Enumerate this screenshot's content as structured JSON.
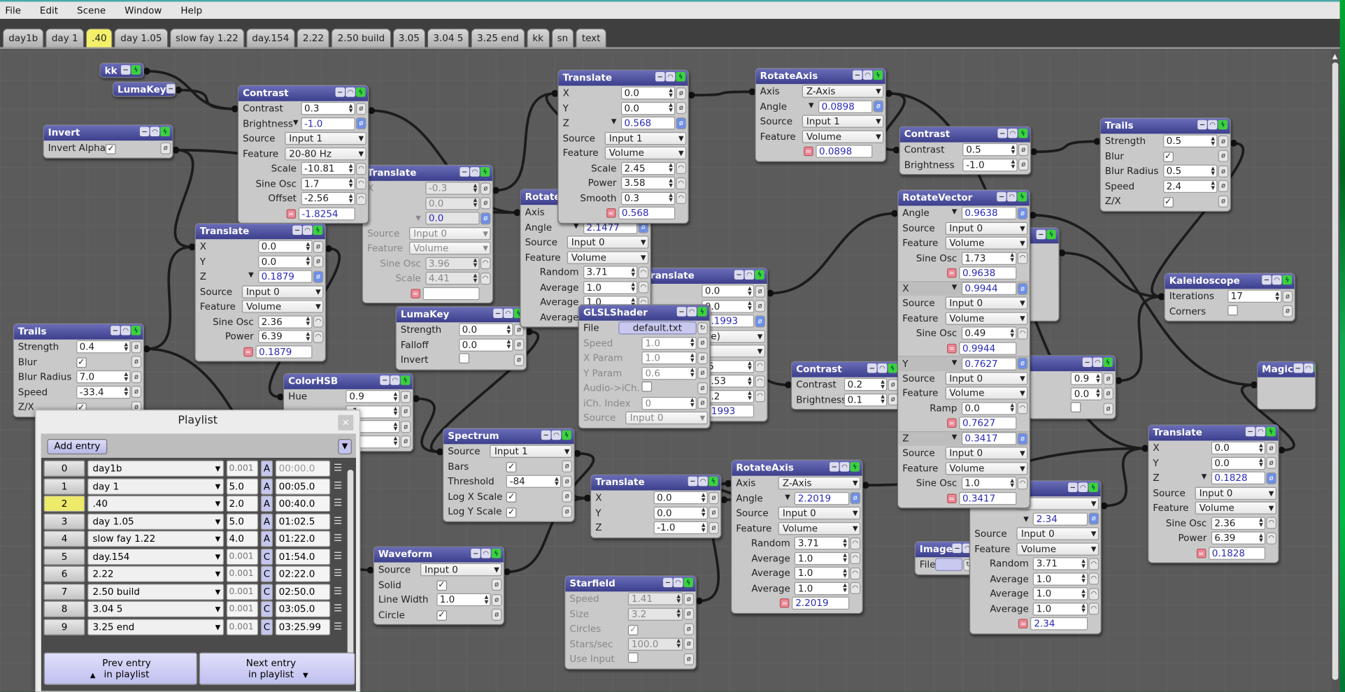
{
  "menu": [
    "File",
    "Edit",
    "Scene",
    "Window",
    "Help"
  ],
  "tabs": {
    "items": [
      "day1b",
      "day 1",
      ".40",
      "day 1.05",
      "slow fay 1.22",
      "day.154",
      "2.22",
      "2.50 build",
      "3.05",
      "3.04 5",
      "3.25 end",
      "kk",
      "sn",
      "text"
    ],
    "active": ".40"
  },
  "colors": {
    "node_header": "#3c3f8c",
    "active_tab": "#f4f06a",
    "result_value": "#2a2ab8",
    "canvas": "#5b5b5b"
  },
  "nodes": [
    {
      "title": "kk",
      "rows": []
    },
    {
      "title": "LumaKey",
      "rows": []
    },
    {
      "title": "Translate",
      "disabled": true,
      "rows": [
        {
          "t": "num",
          "l": "X",
          "v": "-0.3"
        },
        {
          "t": "num",
          "l": "",
          "v": "0.0"
        },
        {
          "t": "drop",
          "l": "",
          "v": "0.0"
        },
        {
          "t": "sel",
          "l": "Source",
          "v": "Input 0"
        },
        {
          "t": "sel",
          "l": "Feature",
          "v": "Volume"
        },
        {
          "t": "mod",
          "l": "Sine Osc",
          "v": "3.96"
        },
        {
          "t": "mod",
          "l": "Scale",
          "v": "4.41"
        },
        {
          "t": "res",
          "v": ""
        }
      ]
    },
    {
      "title": "Contrast",
      "rows": [
        {
          "t": "num",
          "l": "Contrast",
          "v": "0.3"
        },
        {
          "t": "drop",
          "l": "Brightness",
          "v": "-1.0"
        },
        {
          "t": "sel",
          "l": "Source",
          "v": "Input 1"
        },
        {
          "t": "sel",
          "l": "Feature",
          "v": "20-80 Hz"
        },
        {
          "t": "mod",
          "l": "Scale",
          "v": "-10.81"
        },
        {
          "t": "mod",
          "l": "Sine Osc",
          "v": "1.7"
        },
        {
          "t": "mod",
          "l": "Offset",
          "v": "-2.56"
        },
        {
          "t": "res",
          "v": "-1.8254"
        }
      ]
    },
    {
      "title": "Invert",
      "rows": [
        {
          "t": "chk",
          "l": "Invert Alpha",
          "v": true
        }
      ]
    },
    {
      "title": "Translate",
      "rows": [
        {
          "t": "num",
          "l": "X",
          "v": "0.0"
        },
        {
          "t": "num",
          "l": "Y",
          "v": "0.0"
        },
        {
          "t": "drop",
          "l": "Z",
          "v": "0.1879"
        },
        {
          "t": "sel",
          "l": "Source",
          "v": "Input 0"
        },
        {
          "t": "sel",
          "l": "Feature",
          "v": "Volume"
        },
        {
          "t": "mod",
          "l": "Sine Osc",
          "v": "2.36"
        },
        {
          "t": "mod",
          "l": "Power",
          "v": "6.39"
        },
        {
          "t": "res",
          "v": "0.1879"
        }
      ]
    },
    {
      "title": "Trails",
      "rows": [
        {
          "t": "num",
          "l": "Strength",
          "v": "0.4"
        },
        {
          "t": "chk",
          "l": "Blur",
          "v": true
        },
        {
          "t": "num",
          "l": "Blur Radius",
          "v": "7.0"
        },
        {
          "t": "num",
          "l": "Speed",
          "v": "-33.4"
        },
        {
          "t": "chk",
          "l": "Z/X",
          "v": true
        }
      ]
    },
    {
      "title": "ColorHSB",
      "rows": [
        {
          "t": "num",
          "l": "Hue",
          "v": "0.9"
        },
        {
          "t": "num",
          "l": "",
          "v": ".1"
        },
        {
          "t": "num",
          "l": "",
          "v": ".1"
        },
        {
          "t": "num",
          "l": "",
          "v": ".0"
        }
      ]
    },
    {
      "title": "LumaKey",
      "rows": [
        {
          "t": "num",
          "l": "Strength",
          "v": "0.0"
        },
        {
          "t": "num",
          "l": "Falloff",
          "v": "0.0"
        },
        {
          "t": "chk",
          "l": "Invert",
          "v": false
        }
      ]
    },
    {
      "title": "Translate",
      "rows": [
        {
          "t": "num",
          "l": "",
          "v": "0.0"
        },
        {
          "t": "num",
          "l": "",
          "v": "0.0"
        },
        {
          "t": "drop",
          "l": "",
          "v": "0.1993"
        },
        {
          "t": "sel",
          "l": "",
          "v": "ource)"
        },
        {
          "t": "sel",
          "l": "",
          "v": "ne"
        },
        {
          "t": "mod",
          "l": "",
          "v": ".5"
        },
        {
          "t": "mod",
          "l": "",
          "v": "5.53"
        },
        {
          "t": "mod",
          "l": "",
          "v": "0.2"
        },
        {
          "t": "res",
          "v": "0.1993"
        }
      ]
    },
    {
      "title": "RotateAxis",
      "rows": [
        {
          "t": "sel",
          "l": "Axis",
          "v": ""
        },
        {
          "t": "drop",
          "l": "Angle",
          "v": "2.1477"
        },
        {
          "t": "sel",
          "l": "Source",
          "v": "Input 0"
        },
        {
          "t": "sel",
          "l": "Feature",
          "v": "Volume"
        },
        {
          "t": "mod",
          "l": "Random",
          "v": "3.71"
        },
        {
          "t": "mod",
          "l": "Average",
          "v": "1.0"
        },
        {
          "t": "mod",
          "l": "Average",
          "v": "1.0"
        },
        {
          "t": "mod",
          "l": "Average",
          "v": ""
        }
      ]
    },
    {
      "title": "Translate",
      "rows": [
        {
          "t": "num",
          "l": "X",
          "v": "0.0"
        },
        {
          "t": "num",
          "l": "Y",
          "v": "0.0"
        },
        {
          "t": "drop",
          "l": "Z",
          "v": "0.568"
        },
        {
          "t": "sel",
          "l": "Source",
          "v": "Input 1"
        },
        {
          "t": "sel",
          "l": "Feature",
          "v": "Volume"
        },
        {
          "t": "mod",
          "l": "Scale",
          "v": "2.45"
        },
        {
          "t": "mod",
          "l": "Power",
          "v": "3.58"
        },
        {
          "t": "mod",
          "l": "Smooth",
          "v": "0.3"
        },
        {
          "t": "res",
          "v": "0.568"
        }
      ]
    },
    {
      "title": "GLSLShader",
      "rows": [
        {
          "t": "file",
          "l": "File",
          "v": "default.txt"
        },
        {
          "t": "num",
          "l": "Speed",
          "v": "1.0",
          "dim": true
        },
        {
          "t": "num",
          "l": "X Param",
          "v": "1.0",
          "dim": true
        },
        {
          "t": "num",
          "l": "Y Param",
          "v": "0.6",
          "dim": true
        },
        {
          "t": "chk",
          "l": "Audio->iCh.",
          "v": false,
          "dim": true
        },
        {
          "t": "num",
          "l": "iCh. Index",
          "v": "0",
          "dim": true
        },
        {
          "t": "sel",
          "l": "Source",
          "v": "Input 0",
          "dim": true
        }
      ]
    },
    {
      "title": "Spectrum",
      "rows": [
        {
          "t": "sel",
          "l": "Source",
          "v": "Input 1"
        },
        {
          "t": "chk",
          "l": "Bars",
          "v": true
        },
        {
          "t": "num",
          "l": "Threshold",
          "v": "-84"
        },
        {
          "t": "chk",
          "l": "Log X Scale",
          "v": true
        },
        {
          "t": "chk",
          "l": "Log Y Scale",
          "v": true
        }
      ]
    },
    {
      "title": "Waveform",
      "rows": [
        {
          "t": "sel",
          "l": "Source",
          "v": "Input 0"
        },
        {
          "t": "chk",
          "l": "Solid",
          "v": true
        },
        {
          "t": "num",
          "l": "Line Width",
          "v": "1.0"
        },
        {
          "t": "chk",
          "l": "Circle",
          "v": true
        }
      ]
    },
    {
      "title": "Translate",
      "rows": [
        {
          "t": "num",
          "l": "X",
          "v": "0.0"
        },
        {
          "t": "num",
          "l": "Y",
          "v": "0.0"
        },
        {
          "t": "num",
          "l": "Z",
          "v": "-1.0"
        }
      ]
    },
    {
      "title": "Starfield",
      "disabled": true,
      "rows": [
        {
          "t": "num",
          "l": "Speed",
          "v": "1.41"
        },
        {
          "t": "num",
          "l": "Size",
          "v": "3.2"
        },
        {
          "t": "chk",
          "l": "Circles",
          "v": true
        },
        {
          "t": "num",
          "l": "Stars/sec",
          "v": "100.0"
        },
        {
          "t": "chk",
          "l": "Use Input",
          "v": false
        }
      ]
    },
    {
      "title": "RotateAxis",
      "rows": [
        {
          "t": "sel",
          "l": "Axis",
          "v": "Z-Axis"
        },
        {
          "t": "drop",
          "l": "Angle",
          "v": "2.2019"
        },
        {
          "t": "sel",
          "l": "Source",
          "v": "Input 0"
        },
        {
          "t": "sel",
          "l": "Feature",
          "v": "Volume"
        },
        {
          "t": "mod",
          "l": "Random",
          "v": "3.71"
        },
        {
          "t": "mod",
          "l": "Average",
          "v": "1.0"
        },
        {
          "t": "mod",
          "l": "Average",
          "v": "1.0"
        },
        {
          "t": "mod",
          "l": "Average",
          "v": "1.0"
        },
        {
          "t": "res",
          "v": "2.2019"
        }
      ]
    },
    {
      "title": "RotateAxis",
      "rows": [
        {
          "t": "sel",
          "l": "Axis",
          "v": "Z-Axis"
        },
        {
          "t": "drop",
          "l": "Angle",
          "v": "0.0898"
        },
        {
          "t": "sel",
          "l": "Source",
          "v": "Input 1"
        },
        {
          "t": "sel",
          "l": "Feature",
          "v": "Volume"
        },
        {
          "t": "res",
          "v": "0.0898"
        }
      ]
    },
    {
      "title": "Contrast",
      "rows": [
        {
          "t": "num",
          "l": "Contrast",
          "v": "0.5"
        },
        {
          "t": "num",
          "l": "Brightness",
          "v": "-1.0"
        }
      ]
    },
    {
      "title": "Contrast",
      "rows": [
        {
          "t": "num",
          "l": "Contrast",
          "v": "0.2"
        },
        {
          "t": "num",
          "l": "Brightness",
          "v": "0.1"
        }
      ]
    },
    {
      "title": "Trails",
      "rows": [
        {
          "t": "num",
          "l": "Strength",
          "v": "0.5"
        },
        {
          "t": "chk",
          "l": "Blur",
          "v": true
        },
        {
          "t": "num",
          "l": "Blur Radius",
          "v": "0.5"
        },
        {
          "t": "num",
          "l": "Speed",
          "v": "2.4"
        },
        {
          "t": "chk",
          "l": "Z/X",
          "v": true
        }
      ]
    },
    {
      "title": "Image",
      "rows": [
        {
          "t": "file",
          "l": "File",
          "v": ""
        }
      ]
    },
    {
      "title": "",
      "rows": [
        {
          "t": "sel",
          "l": "Axis",
          "v": ""
        },
        {
          "t": "drop",
          "l": "",
          "v": "2.34"
        },
        {
          "t": "sel",
          "l": "Source",
          "v": "Input 0"
        },
        {
          "t": "sel",
          "l": "Feature",
          "v": "Volume"
        },
        {
          "t": "mod",
          "l": "Random",
          "v": "3.71"
        },
        {
          "t": "mod",
          "l": "Average",
          "v": "1.0"
        },
        {
          "t": "mod",
          "l": "Average",
          "v": "1.0"
        },
        {
          "t": "mod",
          "l": "Average",
          "v": "1.0"
        },
        {
          "t": "res",
          "v": "2.34"
        }
      ]
    },
    {
      "title": "",
      "rows": [
        {
          "t": "num",
          "l": "",
          "v": "0.9"
        },
        {
          "t": "num",
          "l": "",
          "v": "0.0"
        },
        {
          "t": "chk",
          "l": "",
          "v": false
        }
      ]
    },
    {
      "title": "",
      "rows": [
        {
          "t": "blank"
        },
        {
          "t": "blank"
        },
        {
          "t": "blank"
        },
        {
          "t": "blank"
        },
        {
          "t": "blank"
        }
      ]
    },
    {
      "title": "Kaleidoscope",
      "rows": [
        {
          "t": "num",
          "l": "Iterations",
          "v": "17"
        },
        {
          "t": "chk",
          "l": "Corners",
          "v": false
        }
      ]
    },
    {
      "title": "Magic",
      "rows": [
        {
          "t": "blank"
        },
        {
          "t": "blank"
        }
      ]
    },
    {
      "title": "Translate",
      "rows": [
        {
          "t": "num",
          "l": "X",
          "v": "0.0"
        },
        {
          "t": "num",
          "l": "Y",
          "v": "0.0"
        },
        {
          "t": "drop",
          "l": "Z",
          "v": "0.1828"
        },
        {
          "t": "sel",
          "l": "Source",
          "v": "Input 0"
        },
        {
          "t": "sel",
          "l": "Feature",
          "v": "Volume"
        },
        {
          "t": "mod",
          "l": "Sine Osc",
          "v": "2.36"
        },
        {
          "t": "mod",
          "l": "Power",
          "v": "6.39"
        },
        {
          "t": "res",
          "v": "0.1828"
        }
      ]
    },
    {
      "title": "RotateVector",
      "rows": [
        {
          "t": "drop",
          "l": "Angle",
          "v": "0.9638"
        },
        {
          "t": "sel",
          "l": "Source",
          "v": "Input 0"
        },
        {
          "t": "sel",
          "l": "Feature",
          "v": "Volume"
        },
        {
          "t": "mod",
          "l": "Sine Osc",
          "v": "1.73"
        },
        {
          "t": "res",
          "v": "0.9638"
        },
        {
          "t": "drop",
          "l": "X",
          "v": "0.9944",
          "sep": true
        },
        {
          "t": "sel",
          "l": "Source",
          "v": "Input 0"
        },
        {
          "t": "sel",
          "l": "Feature",
          "v": "Volume"
        },
        {
          "t": "mod",
          "l": "Sine Osc",
          "v": "0.49"
        },
        {
          "t": "res",
          "v": "0.9944"
        },
        {
          "t": "drop",
          "l": "Y",
          "v": "0.7627",
          "sep": true
        },
        {
          "t": "sel",
          "l": "Source",
          "v": "Input 0"
        },
        {
          "t": "sel",
          "l": "Feature",
          "v": "Volume"
        },
        {
          "t": "mod",
          "l": "Ramp",
          "v": "0.0"
        },
        {
          "t": "res",
          "v": "0.7627"
        },
        {
          "t": "drop",
          "l": "Z",
          "v": "0.3417",
          "sep": true
        },
        {
          "t": "sel",
          "l": "Source",
          "v": "Input 0"
        },
        {
          "t": "sel",
          "l": "Feature",
          "v": "Volume"
        },
        {
          "t": "mod",
          "l": "Sine Osc",
          "v": "1.0"
        },
        {
          "t": "res",
          "v": "0.3417"
        }
      ]
    }
  ],
  "playlist": {
    "title": "Playlist",
    "close": "×",
    "add_entry": "Add entry",
    "current_index": 2,
    "entries": [
      {
        "idx": "0",
        "name": "day1b",
        "dur": "0.001",
        "mode": "A",
        "time": "00:00.0"
      },
      {
        "idx": "1",
        "name": "day 1",
        "dur": "5.0",
        "mode": "A",
        "time": "00:05.0"
      },
      {
        "idx": "2",
        "name": ".40",
        "dur": "2.0",
        "mode": "A",
        "time": "00:40.0"
      },
      {
        "idx": "3",
        "name": "day 1.05",
        "dur": "5.0",
        "mode": "A",
        "time": "01:02.5"
      },
      {
        "idx": "4",
        "name": "slow fay 1.22",
        "dur": "4.0",
        "mode": "A",
        "time": "01:22.0"
      },
      {
        "idx": "5",
        "name": "day.154",
        "dur": "0.001",
        "mode": "C",
        "time": "01:54.0"
      },
      {
        "idx": "6",
        "name": "2.22",
        "dur": "0.001",
        "mode": "C",
        "time": "02:22.0"
      },
      {
        "idx": "7",
        "name": "2.50 build",
        "dur": "0.001",
        "mode": "C",
        "time": "02:50.0"
      },
      {
        "idx": "8",
        "name": "3.04 5",
        "dur": "0.001",
        "mode": "C",
        "time": "03:05.0"
      },
      {
        "idx": "9",
        "name": "3.25 end",
        "dur": "0.001",
        "mode": "C",
        "time": "03:25.99"
      }
    ],
    "prev": {
      "line1": "Prev entry",
      "line2": "in playlist"
    },
    "next": {
      "line1": "Next entry",
      "line2": "in playlist"
    }
  }
}
